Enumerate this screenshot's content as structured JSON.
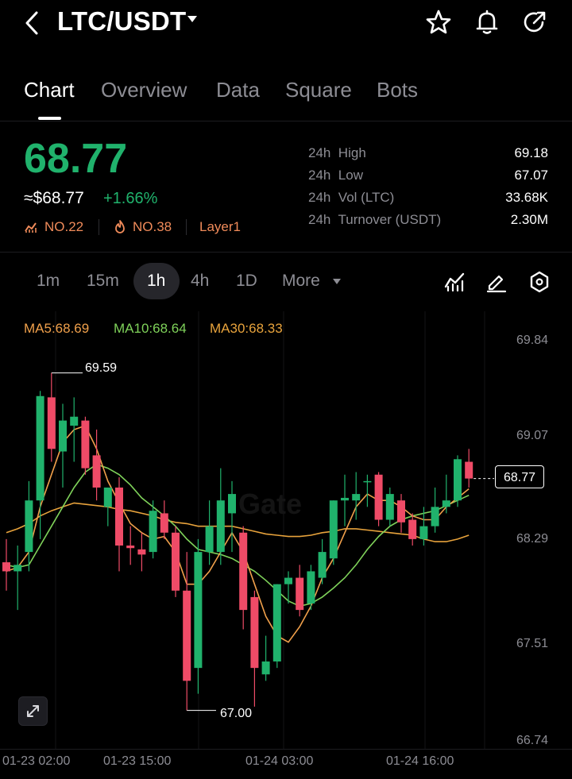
{
  "header": {
    "pair": "LTC/USDT",
    "icons": [
      "back-arrow-icon",
      "star-icon",
      "bell-icon",
      "share-icon"
    ]
  },
  "tabs": [
    {
      "label": "Chart",
      "active": true
    },
    {
      "label": "Overview",
      "active": false
    },
    {
      "label": "Data",
      "active": false
    },
    {
      "label": "Square",
      "active": false
    },
    {
      "label": "Bots",
      "active": false
    }
  ],
  "ticker": {
    "price": "68.77",
    "price_usd": "≈$68.77",
    "change": "+1.66%",
    "rank_vol": "NO.22",
    "rank_hot": "NO.38",
    "tag": "Layer1"
  },
  "stats": [
    {
      "label": "24h  High",
      "value": "69.18"
    },
    {
      "label": "24h  Low",
      "value": "67.07"
    },
    {
      "label": "24h  Vol (LTC)",
      "value": "33.68K"
    },
    {
      "label": "24h  Turnover (USDT)",
      "value": "2.30M"
    }
  ],
  "timeframes": [
    {
      "label": "1m",
      "active": false
    },
    {
      "label": "15m",
      "active": false
    },
    {
      "label": "1h",
      "active": true
    },
    {
      "label": "4h",
      "active": false
    },
    {
      "label": "1D",
      "active": false
    },
    {
      "label": "More",
      "active": false
    }
  ],
  "tool_icons": [
    "indicator-icon",
    "draw-pencil-icon",
    "settings-hex-icon"
  ],
  "ma": {
    "ma5": "MA5:68.69",
    "ma10": "MA10:68.64",
    "ma30": "MA30:68.33"
  },
  "colors": {
    "up": "#20b26c",
    "down": "#ef4b67",
    "ma5": "#f0a04b",
    "ma10": "#7fd25a",
    "ma30": "#e8a33c"
  },
  "chart": {
    "watermark": "Gate",
    "last_price_label": "68.77",
    "high_label": "69.59",
    "low_label": "67.00",
    "y_ticks": [
      "69.84",
      "69.07",
      "68.29",
      "67.51",
      "66.74"
    ],
    "x_ticks": [
      "01-23 02:00",
      "01-23 15:00",
      "01-24 03:00",
      "01-24 16:00"
    ]
  },
  "chart_data": {
    "type": "candlestick",
    "ylim": [
      66.74,
      69.84
    ],
    "candles": [
      {
        "o": 68.12,
        "h": 68.3,
        "l": 67.9,
        "c": 68.05
      },
      {
        "o": 68.05,
        "h": 68.25,
        "l": 67.75,
        "c": 68.1
      },
      {
        "o": 68.2,
        "h": 68.75,
        "l": 68.05,
        "c": 68.6
      },
      {
        "o": 68.6,
        "h": 69.45,
        "l": 68.3,
        "c": 69.41
      },
      {
        "o": 69.4,
        "h": 69.59,
        "l": 68.9,
        "c": 69.0
      },
      {
        "o": 68.98,
        "h": 69.35,
        "l": 68.7,
        "c": 69.22
      },
      {
        "o": 69.18,
        "h": 69.4,
        "l": 68.9,
        "c": 69.25
      },
      {
        "o": 69.22,
        "h": 69.25,
        "l": 68.8,
        "c": 68.85
      },
      {
        "o": 68.95,
        "h": 69.15,
        "l": 68.6,
        "c": 68.7
      },
      {
        "o": 68.55,
        "h": 68.7,
        "l": 68.4,
        "c": 68.7
      },
      {
        "o": 68.7,
        "h": 68.78,
        "l": 68.05,
        "c": 68.25
      },
      {
        "o": 68.25,
        "h": 68.4,
        "l": 68.1,
        "c": 68.23
      },
      {
        "o": 68.22,
        "h": 68.35,
        "l": 68.05,
        "c": 68.18
      },
      {
        "o": 68.2,
        "h": 68.6,
        "l": 68.15,
        "c": 68.52
      },
      {
        "o": 68.5,
        "h": 68.6,
        "l": 68.3,
        "c": 68.35
      },
      {
        "o": 68.35,
        "h": 68.4,
        "l": 67.85,
        "c": 67.9
      },
      {
        "o": 67.9,
        "h": 68.2,
        "l": 66.97,
        "c": 67.2
      },
      {
        "o": 67.3,
        "h": 68.3,
        "l": 67.1,
        "c": 68.2
      },
      {
        "o": 68.2,
        "h": 68.6,
        "l": 68.1,
        "c": 68.4
      },
      {
        "o": 68.2,
        "h": 68.85,
        "l": 68.1,
        "c": 68.6
      },
      {
        "o": 68.5,
        "h": 68.75,
        "l": 68.2,
        "c": 68.65
      },
      {
        "o": 68.35,
        "h": 68.4,
        "l": 67.6,
        "c": 67.75
      },
      {
        "o": 67.85,
        "h": 67.9,
        "l": 67.0,
        "c": 67.3
      },
      {
        "o": 67.25,
        "h": 67.55,
        "l": 67.2,
        "c": 67.35
      },
      {
        "o": 67.35,
        "h": 67.95,
        "l": 67.3,
        "c": 67.95
      },
      {
        "o": 67.95,
        "h": 68.05,
        "l": 67.8,
        "c": 68.0
      },
      {
        "o": 68.0,
        "h": 68.1,
        "l": 67.7,
        "c": 67.75
      },
      {
        "o": 67.8,
        "h": 68.1,
        "l": 67.75,
        "c": 68.05
      },
      {
        "o": 68.0,
        "h": 68.3,
        "l": 67.95,
        "c": 68.2
      },
      {
        "o": 68.15,
        "h": 68.6,
        "l": 68.1,
        "c": 68.6
      },
      {
        "o": 68.6,
        "h": 68.8,
        "l": 68.4,
        "c": 68.62
      },
      {
        "o": 68.6,
        "h": 68.82,
        "l": 68.45,
        "c": 68.65
      },
      {
        "o": 68.75,
        "h": 68.8,
        "l": 68.55,
        "c": 68.75
      },
      {
        "o": 68.8,
        "h": 68.82,
        "l": 68.4,
        "c": 68.45
      },
      {
        "o": 68.45,
        "h": 68.7,
        "l": 68.4,
        "c": 68.65
      },
      {
        "o": 68.6,
        "h": 68.65,
        "l": 68.35,
        "c": 68.43
      },
      {
        "o": 68.45,
        "h": 68.5,
        "l": 68.25,
        "c": 68.3
      },
      {
        "o": 68.3,
        "h": 68.55,
        "l": 68.25,
        "c": 68.4
      },
      {
        "o": 68.4,
        "h": 68.7,
        "l": 68.35,
        "c": 68.55
      },
      {
        "o": 68.55,
        "h": 68.8,
        "l": 68.5,
        "c": 68.6
      },
      {
        "o": 68.6,
        "h": 68.95,
        "l": 68.55,
        "c": 68.92
      },
      {
        "o": 68.9,
        "h": 69.0,
        "l": 68.7,
        "c": 68.77
      }
    ],
    "ma5": [
      68.05,
      68.08,
      68.2,
      68.55,
      68.8,
      69.05,
      69.15,
      69.18,
      69.0,
      68.75,
      68.58,
      68.42,
      68.35,
      68.3,
      68.32,
      68.2,
      67.95,
      67.95,
      68.05,
      68.2,
      68.35,
      68.2,
      67.95,
      67.7,
      67.55,
      67.5,
      67.62,
      67.78,
      68.0,
      68.15,
      68.35,
      68.55,
      68.65,
      68.6,
      68.6,
      68.55,
      68.48,
      68.45,
      68.45,
      68.55,
      68.62,
      68.69
    ],
    "ma10": [
      68.1,
      68.08,
      68.1,
      68.25,
      68.4,
      68.55,
      68.7,
      68.82,
      68.88,
      68.85,
      68.8,
      68.72,
      68.62,
      68.55,
      68.48,
      68.4,
      68.3,
      68.22,
      68.2,
      68.18,
      68.15,
      68.1,
      68.05,
      67.98,
      67.9,
      67.82,
      67.78,
      67.8,
      67.85,
      67.92,
      68.0,
      68.1,
      68.22,
      68.32,
      68.4,
      68.45,
      68.48,
      68.5,
      68.52,
      68.56,
      68.6,
      68.64
    ],
    "ma30": [
      68.35,
      68.38,
      68.42,
      68.48,
      68.52,
      68.55,
      68.58,
      68.57,
      68.56,
      68.55,
      68.53,
      68.52,
      68.5,
      68.48,
      68.45,
      68.43,
      68.42,
      68.4,
      68.4,
      68.4,
      68.4,
      68.38,
      68.36,
      68.34,
      68.33,
      68.32,
      68.32,
      68.33,
      68.35,
      68.36,
      68.38,
      68.38,
      68.37,
      68.36,
      68.35,
      68.34,
      68.33,
      68.3,
      68.28,
      68.28,
      68.3,
      68.33
    ]
  }
}
